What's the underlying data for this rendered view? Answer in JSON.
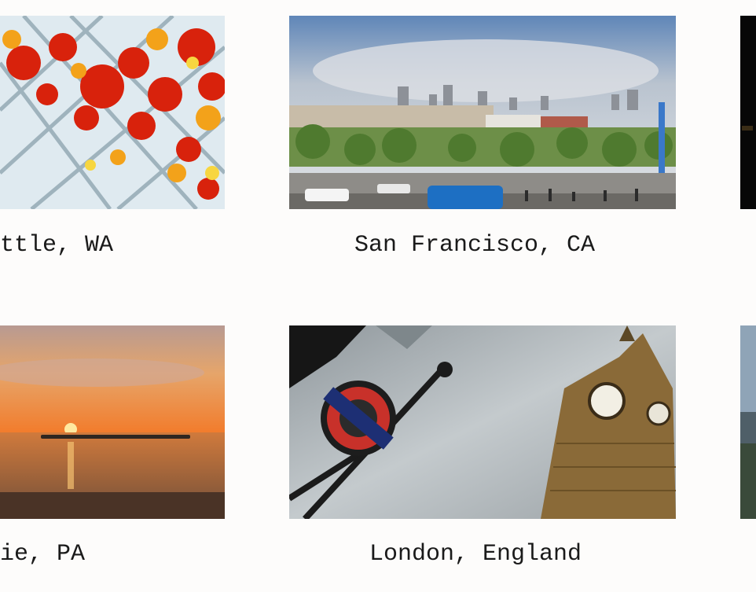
{
  "gallery": {
    "items": [
      {
        "caption": "ttle, WA",
        "photo": "glass-flowers-photo"
      },
      {
        "caption": "San Francisco, CA",
        "photo": "waterfront-city-photo"
      },
      {
        "caption": "ie, PA",
        "photo": "lake-sunset-photo"
      },
      {
        "caption": "London, England",
        "photo": "big-ben-underground-photo"
      }
    ]
  },
  "colors": {
    "background": "#fdfcfb",
    "text": "#1a1a1a"
  }
}
